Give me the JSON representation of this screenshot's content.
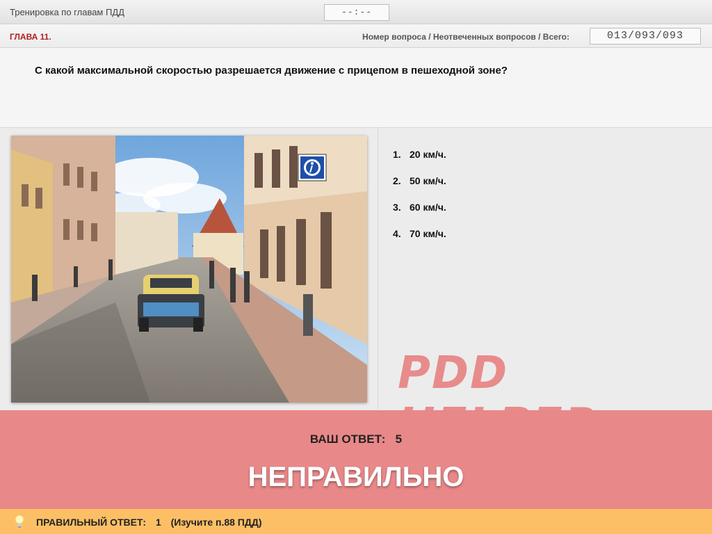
{
  "header": {
    "title": "Тренировка по главам ПДД",
    "timer": "--:--"
  },
  "chapter": {
    "label": "ГЛАВА 11.",
    "counter_label": "Номер вопроса / Неотвеченных вопросов / Всего:",
    "counter_value": "013/093/093"
  },
  "question": {
    "text": "С какой максимальной скоростью разрешается движение с прицепом в пешеходной зоне?"
  },
  "answers": [
    {
      "num": "1.",
      "text": "20 км/ч."
    },
    {
      "num": "2.",
      "text": "50 км/ч."
    },
    {
      "num": "3.",
      "text": "60 км/ч."
    },
    {
      "num": "4.",
      "text": "70 км/ч."
    }
  ],
  "watermark": "PDD HELPER",
  "result": {
    "your_answer_label": "ВАШ  ОТВЕТ:",
    "your_answer_value": "5",
    "verdict": "НЕПРАВИЛЬНО"
  },
  "hint": {
    "label": "ПРАВИЛЬНЫЙ ОТВЕТ:",
    "value": "1",
    "note": "(Изучите п.88 ПДД)"
  },
  "colors": {
    "result_bg": "#e88889",
    "hint_bg": "#fdbf66",
    "chapter_red": "#b02020",
    "watermark": "#e88686"
  }
}
